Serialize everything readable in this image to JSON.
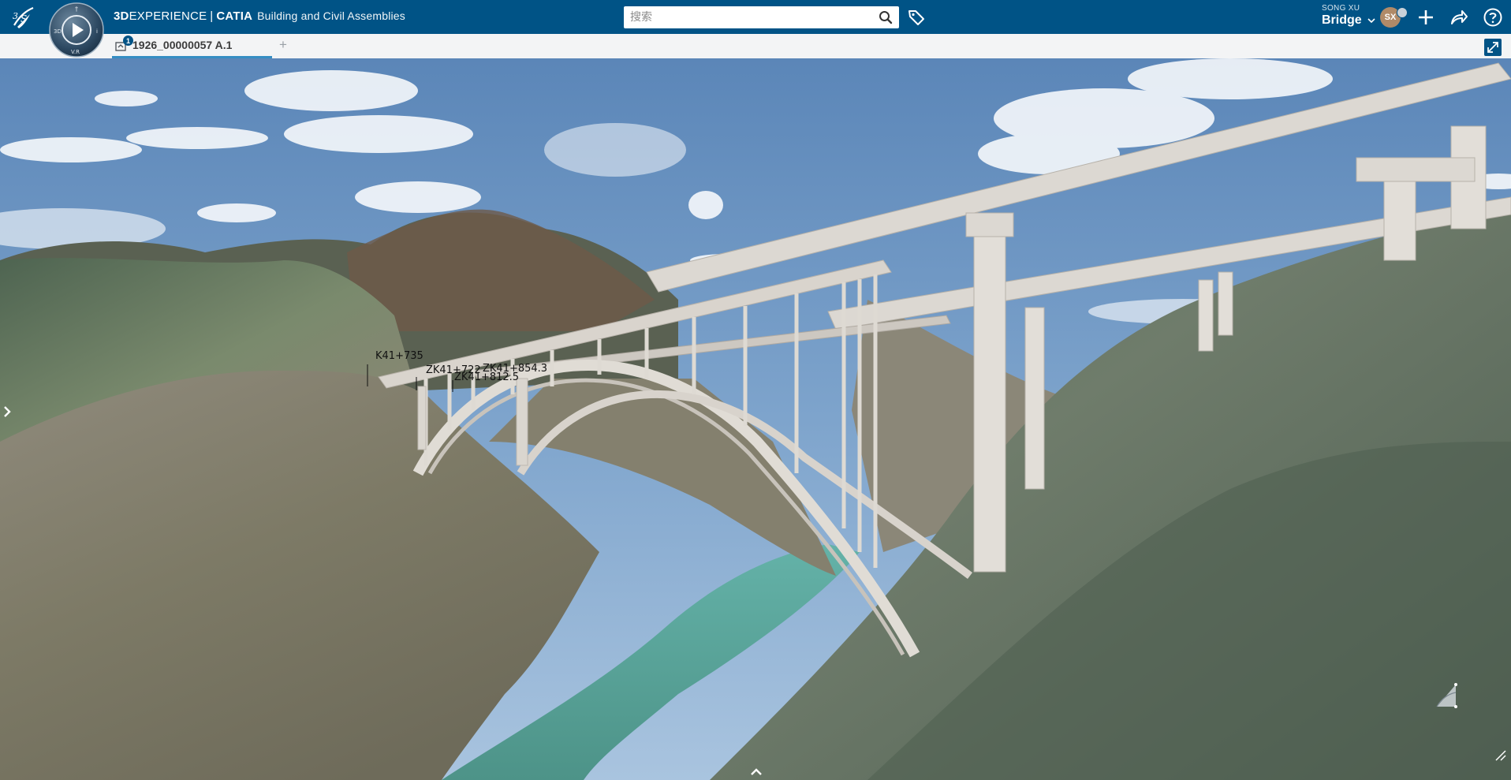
{
  "header": {
    "brand_3d": "3D",
    "brand_experience": "EXPERIENCE",
    "brand_separator": "|",
    "brand_catia": "CATIA",
    "app_name": "Building and Civil Assemblies",
    "search_placeholder": "搜索",
    "user": {
      "name": "SONG XU",
      "space": "Bridge",
      "initials": "SX"
    }
  },
  "tabs": [
    {
      "label": "1926_00000057 A.1",
      "badge": "1",
      "active": true
    }
  ],
  "tab_add_label": "+",
  "viewport": {
    "station_labels": [
      "K41+735",
      "ZK41+722",
      "ZK41+854.3",
      "ZK41+812.5"
    ]
  },
  "colors": {
    "topbar": "#005386",
    "tabbar": "#f3f4f5",
    "tab_underline": "#368ec4",
    "sky": "#5c8bbd",
    "bridge": "#dcd8d2",
    "river": "#5fa59b",
    "terrain": "#6b7b62"
  },
  "icons": {
    "logo": "ds-logo-icon",
    "compass": "compass-icon",
    "search": "search-icon",
    "tag": "tag-icon",
    "add": "plus-icon",
    "share": "share-icon",
    "help": "help-icon",
    "fullscreen": "fullscreen-icon"
  }
}
